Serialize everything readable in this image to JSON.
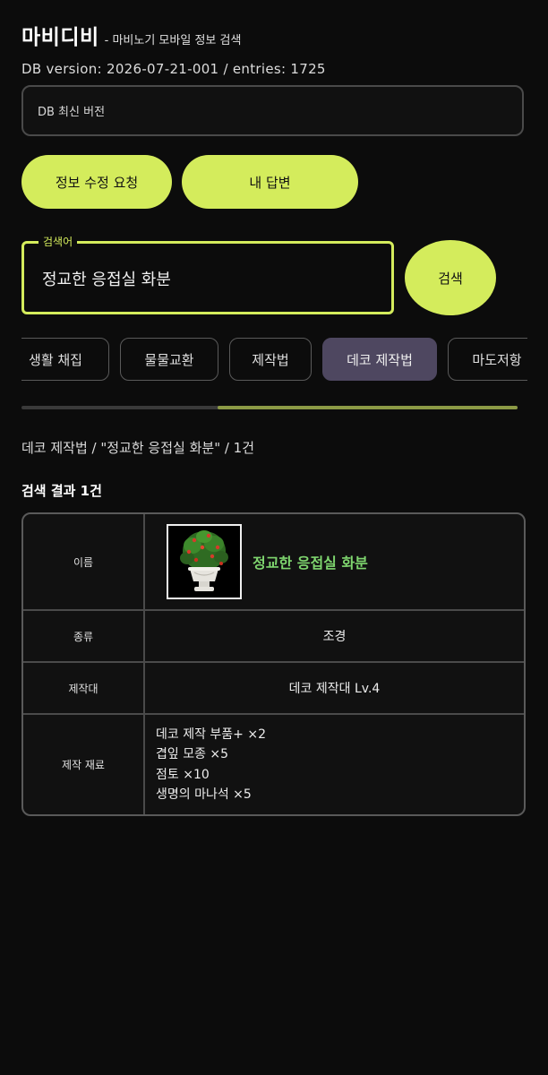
{
  "header": {
    "app_title": "마비디비",
    "app_subtitle": "- 마비노기 모바일 정보 검색",
    "db_version": "DB version: 2026-07-21-001 / entries: 1725"
  },
  "latest_box": {
    "label": "DB 최신 버전"
  },
  "actions": {
    "edit_request_label": "정보 수정 요청",
    "my_answers_label": "내 답변"
  },
  "search": {
    "legend": "검색어",
    "value": "정교한 응접실 화분",
    "button_label": "검색"
  },
  "tabs": [
    {
      "label": "생활 채집",
      "active": false
    },
    {
      "label": "물물교환",
      "active": false
    },
    {
      "label": "제작법",
      "active": false
    },
    {
      "label": "데코 제작법",
      "active": true
    },
    {
      "label": "마도저항",
      "active": false
    }
  ],
  "breadcrumb": "데코 제작법 / \"정교한 응접실 화분\" / 1건",
  "result_heading": "검색 결과 1건",
  "result": {
    "name_label": "이름",
    "name_value": "정교한 응접실 화분",
    "type_label": "종류",
    "type_value": "조경",
    "station_label": "제작대",
    "station_value": "데코 제작대 Lv.4",
    "materials_label": "제작 재료",
    "materials": [
      "데코 제작 부품+ ×2",
      "겹잎 모종 ×5",
      "점토 ×10",
      "생명의 마나석 ×5"
    ]
  },
  "colors": {
    "accent": "#d4ec5c",
    "active_tab": "#4e4760",
    "item_name": "#7fd66f",
    "background": "#0c0c0c"
  },
  "icons": {
    "item_thumbnail": "potted-plant-image"
  }
}
